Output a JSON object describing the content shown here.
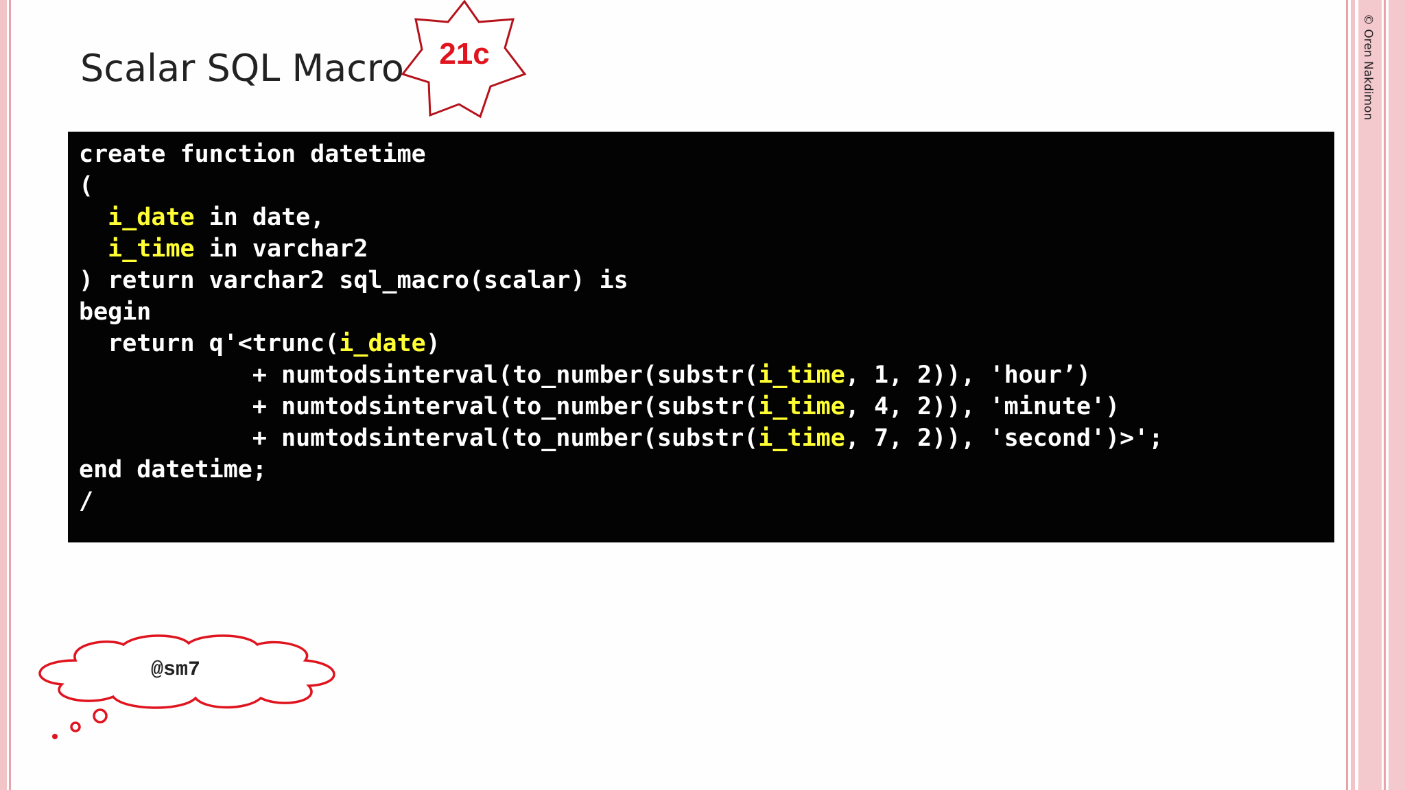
{
  "slide": {
    "title": "Scalar SQL Macro",
    "badge": "21c",
    "copyright": "© Oren Nakdimon",
    "thought_bubble": "@sm7"
  },
  "code": {
    "lines": [
      [
        {
          "t": "create function datetime"
        }
      ],
      [
        {
          "t": "("
        }
      ],
      [
        {
          "t": "  "
        },
        {
          "t": "i_date",
          "hl": true
        },
        {
          "t": " in date,"
        }
      ],
      [
        {
          "t": "  "
        },
        {
          "t": "i_time",
          "hl": true
        },
        {
          "t": " in varchar2"
        }
      ],
      [
        {
          "t": ") return varchar2 sql_macro(scalar) is"
        }
      ],
      [
        {
          "t": "begin"
        }
      ],
      [
        {
          "t": "  return q'<trunc("
        },
        {
          "t": "i_date",
          "hl": true
        },
        {
          "t": ")"
        }
      ],
      [
        {
          "t": "            + numtodsinterval(to_number(substr("
        },
        {
          "t": "i_time",
          "hl": true
        },
        {
          "t": ", 1, 2)), 'hour’)"
        }
      ],
      [
        {
          "t": "            + numtodsinterval(to_number(substr("
        },
        {
          "t": "i_time",
          "hl": true
        },
        {
          "t": ", 4, 2)), 'minute')"
        }
      ],
      [
        {
          "t": "            + numtodsinterval(to_number(substr("
        },
        {
          "t": "i_time",
          "hl": true
        },
        {
          "t": ", 7, 2)), 'second')>';"
        }
      ],
      [
        {
          "t": "end datetime;"
        }
      ],
      [
        {
          "t": "/"
        }
      ]
    ]
  },
  "colors": {
    "code_background": "#030303",
    "code_text": "#ffffff",
    "code_highlight": "#ffff33",
    "badge_red": "#e0141e",
    "border_pink": "#f2c4c8"
  },
  "icons": {
    "badge_shape": "star-burst-icon",
    "bubble_shape": "thought-cloud-icon"
  }
}
